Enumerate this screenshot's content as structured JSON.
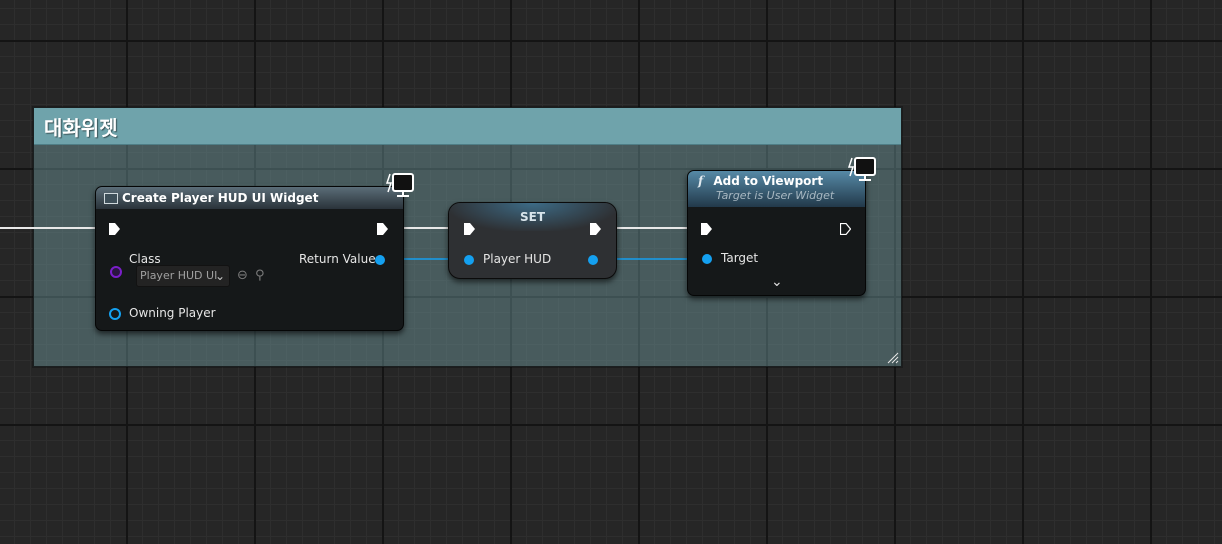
{
  "comment": {
    "title": "대화위젯"
  },
  "create_node": {
    "title": "Create Player HUD UI Widget",
    "class_label": "Class",
    "class_value": "Player HUD UI",
    "return_value_label": "Return Value",
    "owning_player_label": "Owning Player"
  },
  "set_node": {
    "title": "SET",
    "var_label": "Player HUD"
  },
  "viewport_node": {
    "title": "Add to Viewport",
    "subtitle": "Target is User Widget",
    "target_label": "Target"
  },
  "colors": {
    "exec_wire": "#e8e8e8",
    "object_pin": "#14a0f0",
    "class_pin": "#7a1fc9",
    "comment_header": "#6fa3ab"
  },
  "icons": [
    "latent-clock-icon",
    "function-icon",
    "class-icon",
    "chevron-down-icon",
    "use-selected-icon",
    "browse-icon",
    "resize-grip-icon"
  ]
}
